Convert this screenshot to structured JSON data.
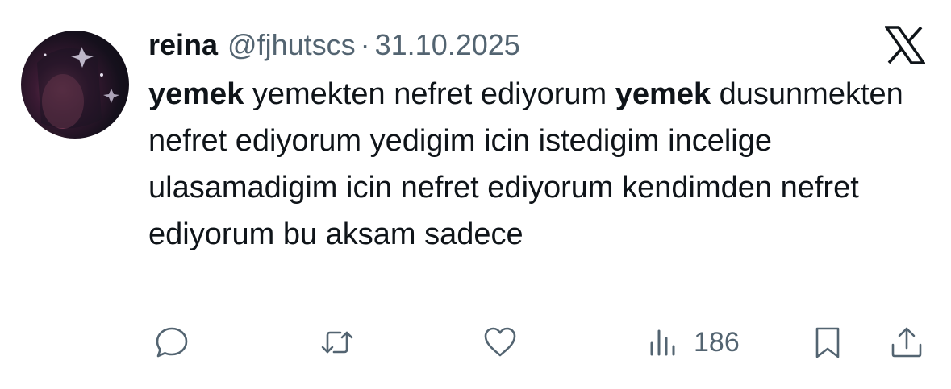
{
  "author": {
    "name": "reina",
    "handle": "@fjhutscs",
    "separator": "·",
    "date": "31.10.2025"
  },
  "tweet": {
    "b1": "yemek",
    "t1": " yemekten nefret ediyorum ",
    "b2": "yemek",
    "t2": " dusunmekten nefret ediyorum yedigim icin istedigim incelige ulasamadigim icin nefret ediyorum kendimden nefret ediyorum bu aksam sadece"
  },
  "stats": {
    "views": "186"
  },
  "icons": {
    "logo": "x-logo-icon",
    "reply": "reply-icon",
    "retweet": "retweet-icon",
    "like": "heart-icon",
    "views": "views-chart-icon",
    "bookmark": "bookmark-icon",
    "share": "share-icon"
  },
  "colors": {
    "text": "#0f1419",
    "secondary": "#536471",
    "background": "#ffffff"
  }
}
